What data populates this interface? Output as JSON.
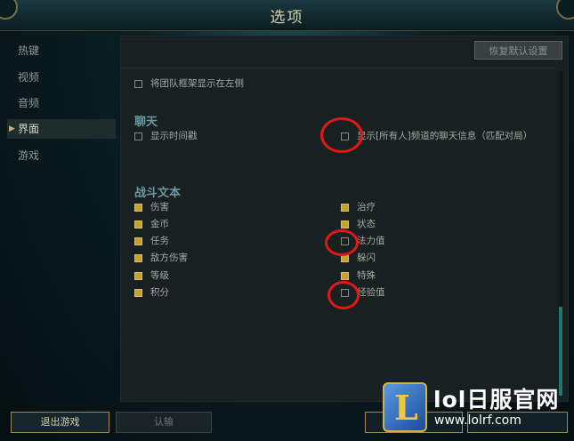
{
  "window": {
    "title": "选项"
  },
  "sidebar": {
    "items": [
      {
        "label": "热键"
      },
      {
        "label": "视频"
      },
      {
        "label": "音频"
      },
      {
        "label": "界面"
      },
      {
        "label": "游戏"
      }
    ]
  },
  "panel": {
    "restore_defaults": "恢复默认设置",
    "team_frames_left": {
      "label": "将团队框架显示在左侧",
      "checked": false
    },
    "chat": {
      "title": "聊天",
      "show_timestamps": {
        "label": "显示时间戳",
        "checked": false
      },
      "show_all_chat": {
        "label": "显示[所有人]频道的聊天信息（匹配对局）",
        "checked": false
      }
    },
    "combat_text": {
      "title": "战斗文本",
      "left": [
        {
          "label": "伤害",
          "checked": true
        },
        {
          "label": "金币",
          "checked": true
        },
        {
          "label": "任务",
          "checked": true
        },
        {
          "label": "敌方伤害",
          "checked": true
        },
        {
          "label": "等级",
          "checked": true
        },
        {
          "label": "积分",
          "checked": true
        }
      ],
      "right": [
        {
          "label": "治疗",
          "checked": true
        },
        {
          "label": "状态",
          "checked": true
        },
        {
          "label": "法力值",
          "checked": false
        },
        {
          "label": "躲闪",
          "checked": true
        },
        {
          "label": "特殊",
          "checked": true
        },
        {
          "label": "经验值",
          "checked": false
        }
      ]
    }
  },
  "footer": {
    "exit_game": "退出游戏",
    "confirm": "认输"
  },
  "watermark": {
    "logo_letter": "L",
    "title": "lol日服官网",
    "url": "www.lolrf.com"
  },
  "colors": {
    "annotation": "#e01818",
    "checked": "#c8a030",
    "accent_gold": "#a08a50"
  }
}
